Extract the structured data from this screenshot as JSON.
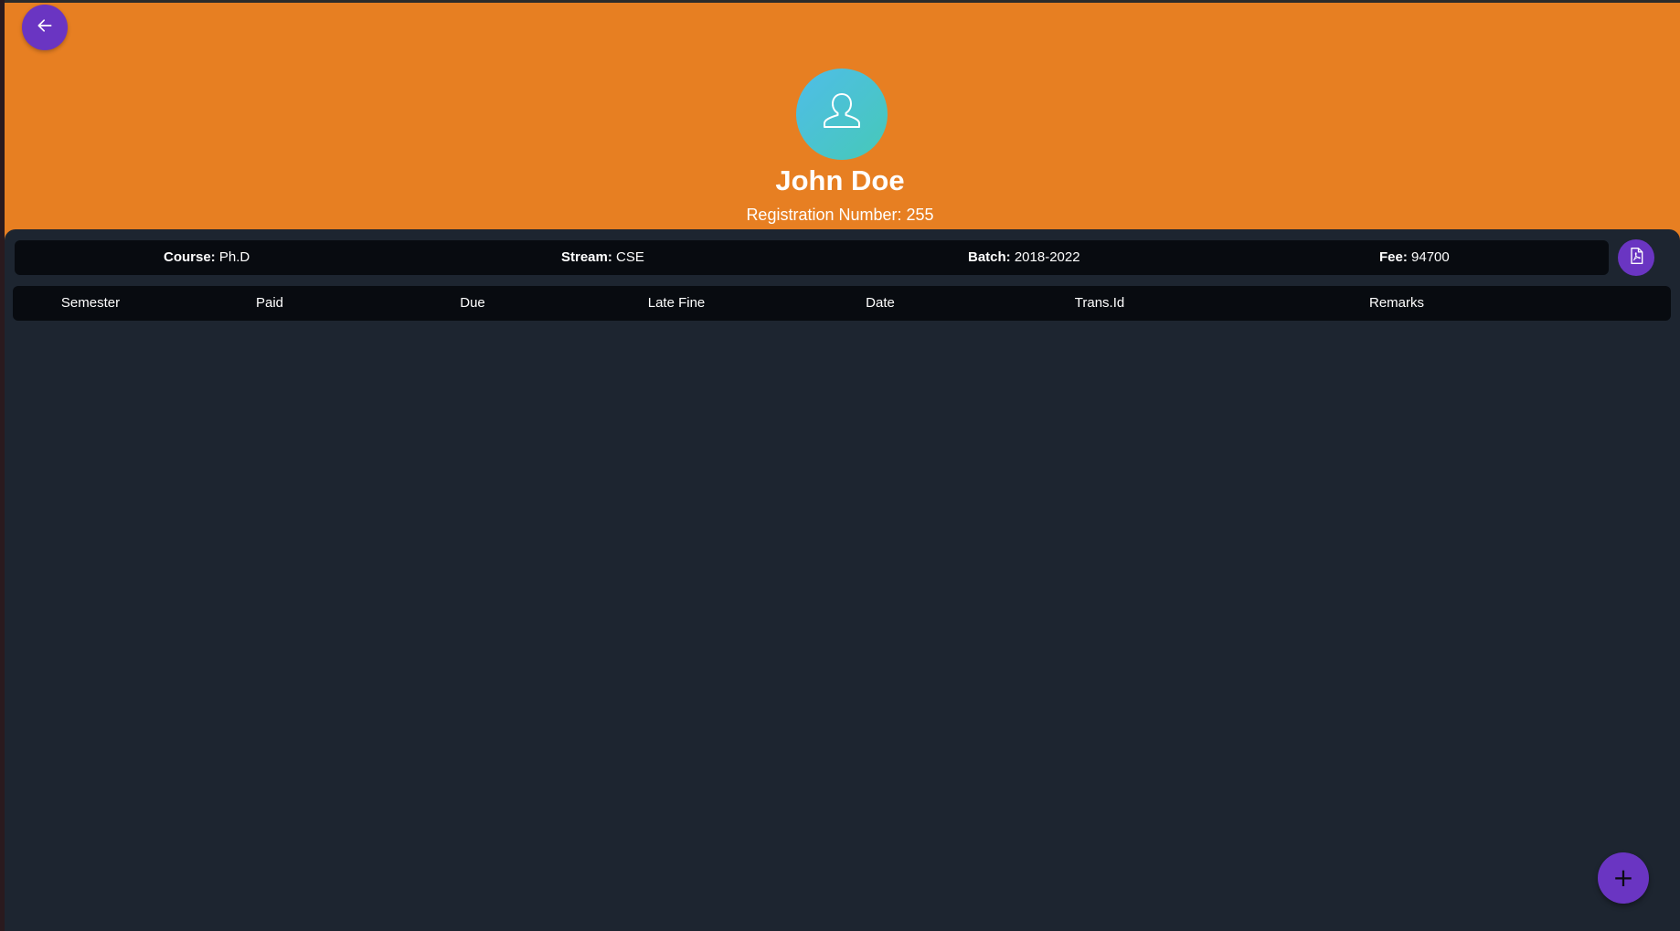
{
  "colors": {
    "header_bg": "#e77f22",
    "panel_bg": "#1d2530",
    "bar_bg": "#080b10",
    "accent": "#6a35c2",
    "avatar_gradient_start": "#4fbde8",
    "avatar_gradient_end": "#46c9b8"
  },
  "header": {
    "back_icon": "arrow-left-icon",
    "avatar_icon": "user-outline-icon"
  },
  "student": {
    "name": "John Doe",
    "registration": "Registration Number: 255"
  },
  "info": {
    "course_label": "Course:",
    "course_value": "Ph.D",
    "stream_label": "Stream:",
    "stream_value": "CSE",
    "batch_label": "Batch:",
    "batch_value": "2018-2022",
    "fee_label": "Fee:",
    "fee_value": "94700",
    "pdf_icon": "pdf-file-icon"
  },
  "table": {
    "columns": [
      "Semester",
      "Paid",
      "Due",
      "Late Fine",
      "Date",
      "Trans.Id",
      "Remarks"
    ],
    "rows": []
  },
  "fab": {
    "icon": "plus-icon",
    "glyph": "+"
  }
}
